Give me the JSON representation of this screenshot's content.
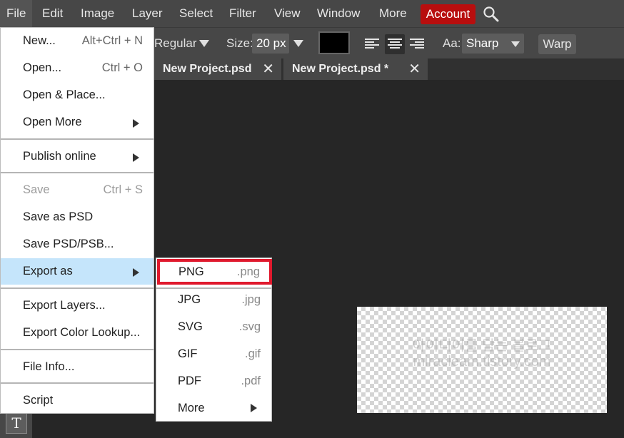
{
  "menubar": {
    "items": [
      "File",
      "Edit",
      "Image",
      "Layer",
      "Select",
      "Filter",
      "View",
      "Window",
      "More"
    ],
    "account_label": "Account",
    "search_icon": "magnifier-icon"
  },
  "options": {
    "font_style": "Regular",
    "size_label": "Size:",
    "size_value": "20 px",
    "text_color": "#000000",
    "antialias_label": "Aa:",
    "antialias_value": "Sharp",
    "warp_label": "Warp",
    "alignment_selected": "center"
  },
  "tabs": [
    {
      "label": "New Project.psd"
    },
    {
      "label": "New Project.psd *"
    }
  ],
  "file_menu": {
    "items": [
      {
        "label": "New...",
        "shortcut": "Alt+Ctrl + N"
      },
      {
        "label": "Open...",
        "shortcut": "Ctrl + O"
      },
      {
        "label": "Open & Place..."
      },
      {
        "label": "Open More"
      },
      {
        "label": "Publish online"
      },
      {
        "label": "Save",
        "shortcut": "Ctrl + S",
        "disabled": true
      },
      {
        "label": "Save as PSD"
      },
      {
        "label": "Save PSD/PSB..."
      },
      {
        "label": "Export as",
        "highlighted": true
      },
      {
        "label": "Export Layers..."
      },
      {
        "label": "Export Color Lookup..."
      },
      {
        "label": "File Info..."
      },
      {
        "label": "Script"
      }
    ]
  },
  "export_menu": {
    "items": [
      {
        "label": "PNG",
        "ext": ".png",
        "outlined": true
      },
      {
        "label": "JPG",
        "ext": ".jpg"
      },
      {
        "label": "SVG",
        "ext": ".svg"
      },
      {
        "label": "GIF",
        "ext": ".gif"
      },
      {
        "label": "PDF",
        "ext": ".pdf"
      },
      {
        "label": "More"
      }
    ]
  },
  "canvas": {
    "watermark_line1": "아이디어를 담는 블로그",
    "watermark_line2": "miracleam.tistory.com"
  },
  "tools": {
    "active_tool_glyph": "T"
  },
  "colors": {
    "menubar_bg": "#474747",
    "workspace_bg": "#262626",
    "account_red": "#b80e0e",
    "menu_highlight": "#c5e5fb",
    "outline_red": "#e0192d"
  }
}
